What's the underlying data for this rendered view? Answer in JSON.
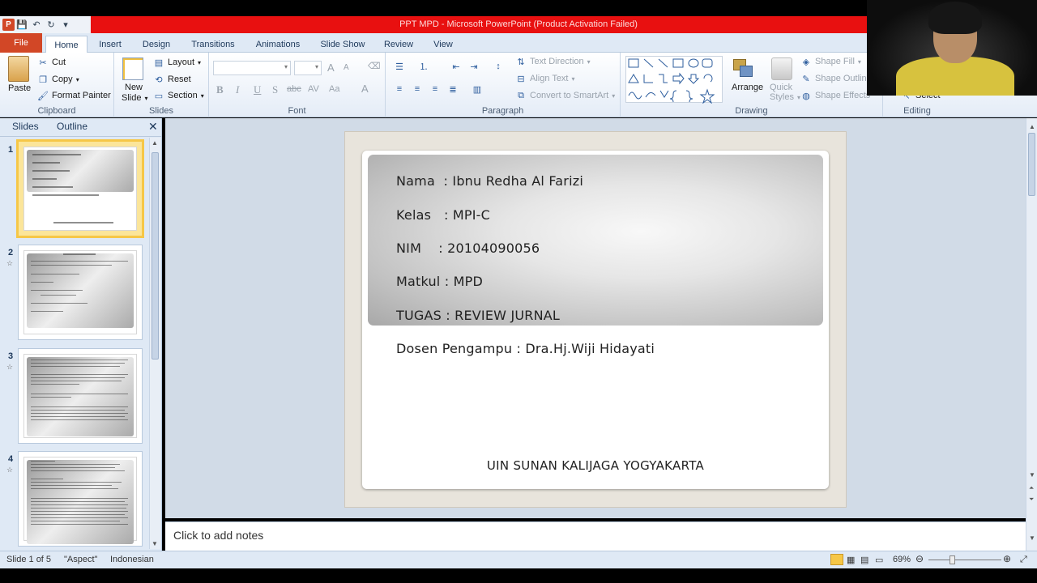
{
  "window": {
    "title": "PPT MPD  -  Microsoft PowerPoint (Product Activation Failed)",
    "title_bar_color": "#e81010",
    "qat": {
      "app_icon": "P",
      "icons": [
        "save-icon",
        "undo-icon",
        "redo-icon",
        "customize-icon"
      ]
    }
  },
  "ribbon_tabs": {
    "file": "File",
    "home": "Home",
    "insert": "Insert",
    "design": "Design",
    "transitions": "Transitions",
    "animations": "Animations",
    "slideshow": "Slide Show",
    "review": "Review",
    "view": "View"
  },
  "clipboard": {
    "paste": "Paste",
    "cut": "Cut",
    "copy": "Copy",
    "format_painter": "Format Painter",
    "label": "Clipboard"
  },
  "slides_group": {
    "new_slide": "New",
    "new_slide2": "Slide",
    "layout": "Layout",
    "reset": "Reset",
    "section": "Section",
    "label": "Slides"
  },
  "font_group": {
    "label": "Font",
    "bold": "B",
    "italic": "I",
    "underline": "U",
    "shadow": "S",
    "strike": "abc",
    "spacing": "AV",
    "case": "Aa",
    "color": "A",
    "grow": "A",
    "shrink": "A"
  },
  "paragraph_group": {
    "label": "Paragraph",
    "text_direction": "Text Direction",
    "align_text": "Align Text",
    "convert_smartart": "Convert to SmartArt"
  },
  "drawing_group": {
    "label": "Drawing",
    "arrange": "Arrange",
    "quick_styles": "Quick",
    "quick_styles2": "Styles",
    "shape_fill": "Shape Fill",
    "shape_outline": "Shape Outline",
    "shape_effects": "Shape Effects"
  },
  "editing_group": {
    "label": "Editing",
    "select": "Select"
  },
  "left_pane": {
    "tab_slides": "Slides",
    "tab_outline": "Outline",
    "numbers": [
      "1",
      "2",
      "3",
      "4"
    ]
  },
  "slide": {
    "nama": "Nama  : Ibnu Redha Al Farizi",
    "kelas": "Kelas   : MPI-C",
    "nim": "NIM    : 20104090056",
    "matkul": "Matkul : MPD",
    "tugas": "TUGAS : REVIEW JURNAL",
    "dosen": "Dosen Pengampu : Dra.Hj.Wiji Hidayati",
    "footer": "UIN SUNAN  KALIJAGA  YOGYAKARTA"
  },
  "notes": {
    "placeholder": "Click to add notes"
  },
  "status": {
    "slide_count": "Slide 1 of 5",
    "theme": "\"Aspect\"",
    "language": "Indonesian",
    "zoom": "69%"
  }
}
